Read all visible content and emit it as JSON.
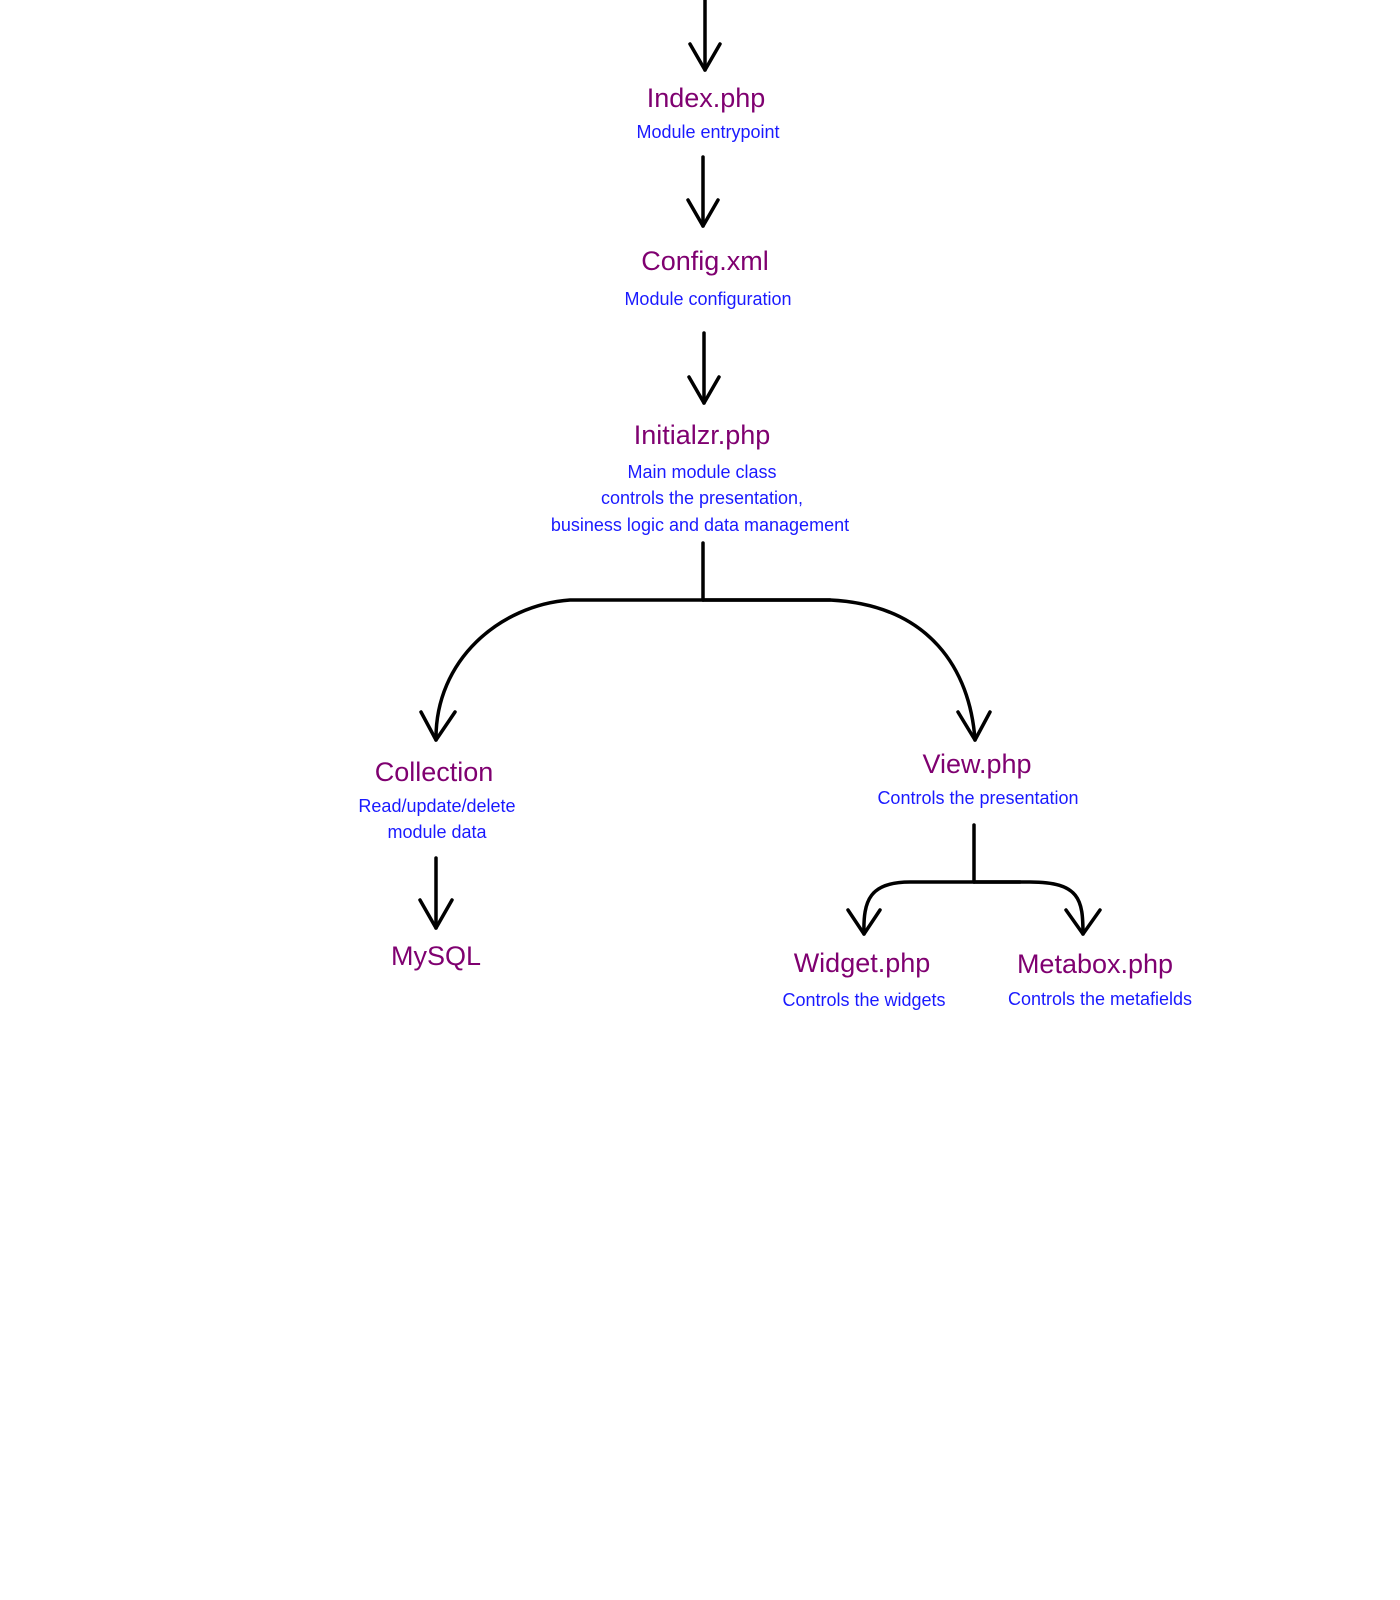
{
  "colors": {
    "title": "#7f0070",
    "subtitle": "#1a1aff",
    "edges": "#000000"
  },
  "nodes": {
    "index": {
      "title": "Index.php",
      "lines": [
        "Module entrypoint"
      ]
    },
    "config": {
      "title": "Config.xml",
      "lines": [
        "Module configuration"
      ]
    },
    "initialzr": {
      "title": "Initialzr.php",
      "lines": [
        "Main module class",
        "controls the presentation,",
        "business logic and data management"
      ]
    },
    "collection": {
      "title": "Collection",
      "lines": [
        "Read/update/delete",
        "module data"
      ]
    },
    "mysql": {
      "title": "MySQL",
      "lines": []
    },
    "view": {
      "title": "View.php",
      "lines": [
        "Controls the presentation"
      ]
    },
    "widget": {
      "title": "Widget.php",
      "lines": [
        "Controls the widgets"
      ]
    },
    "metabox": {
      "title": "Metabox.php",
      "lines": [
        "Controls the metafields"
      ]
    }
  }
}
